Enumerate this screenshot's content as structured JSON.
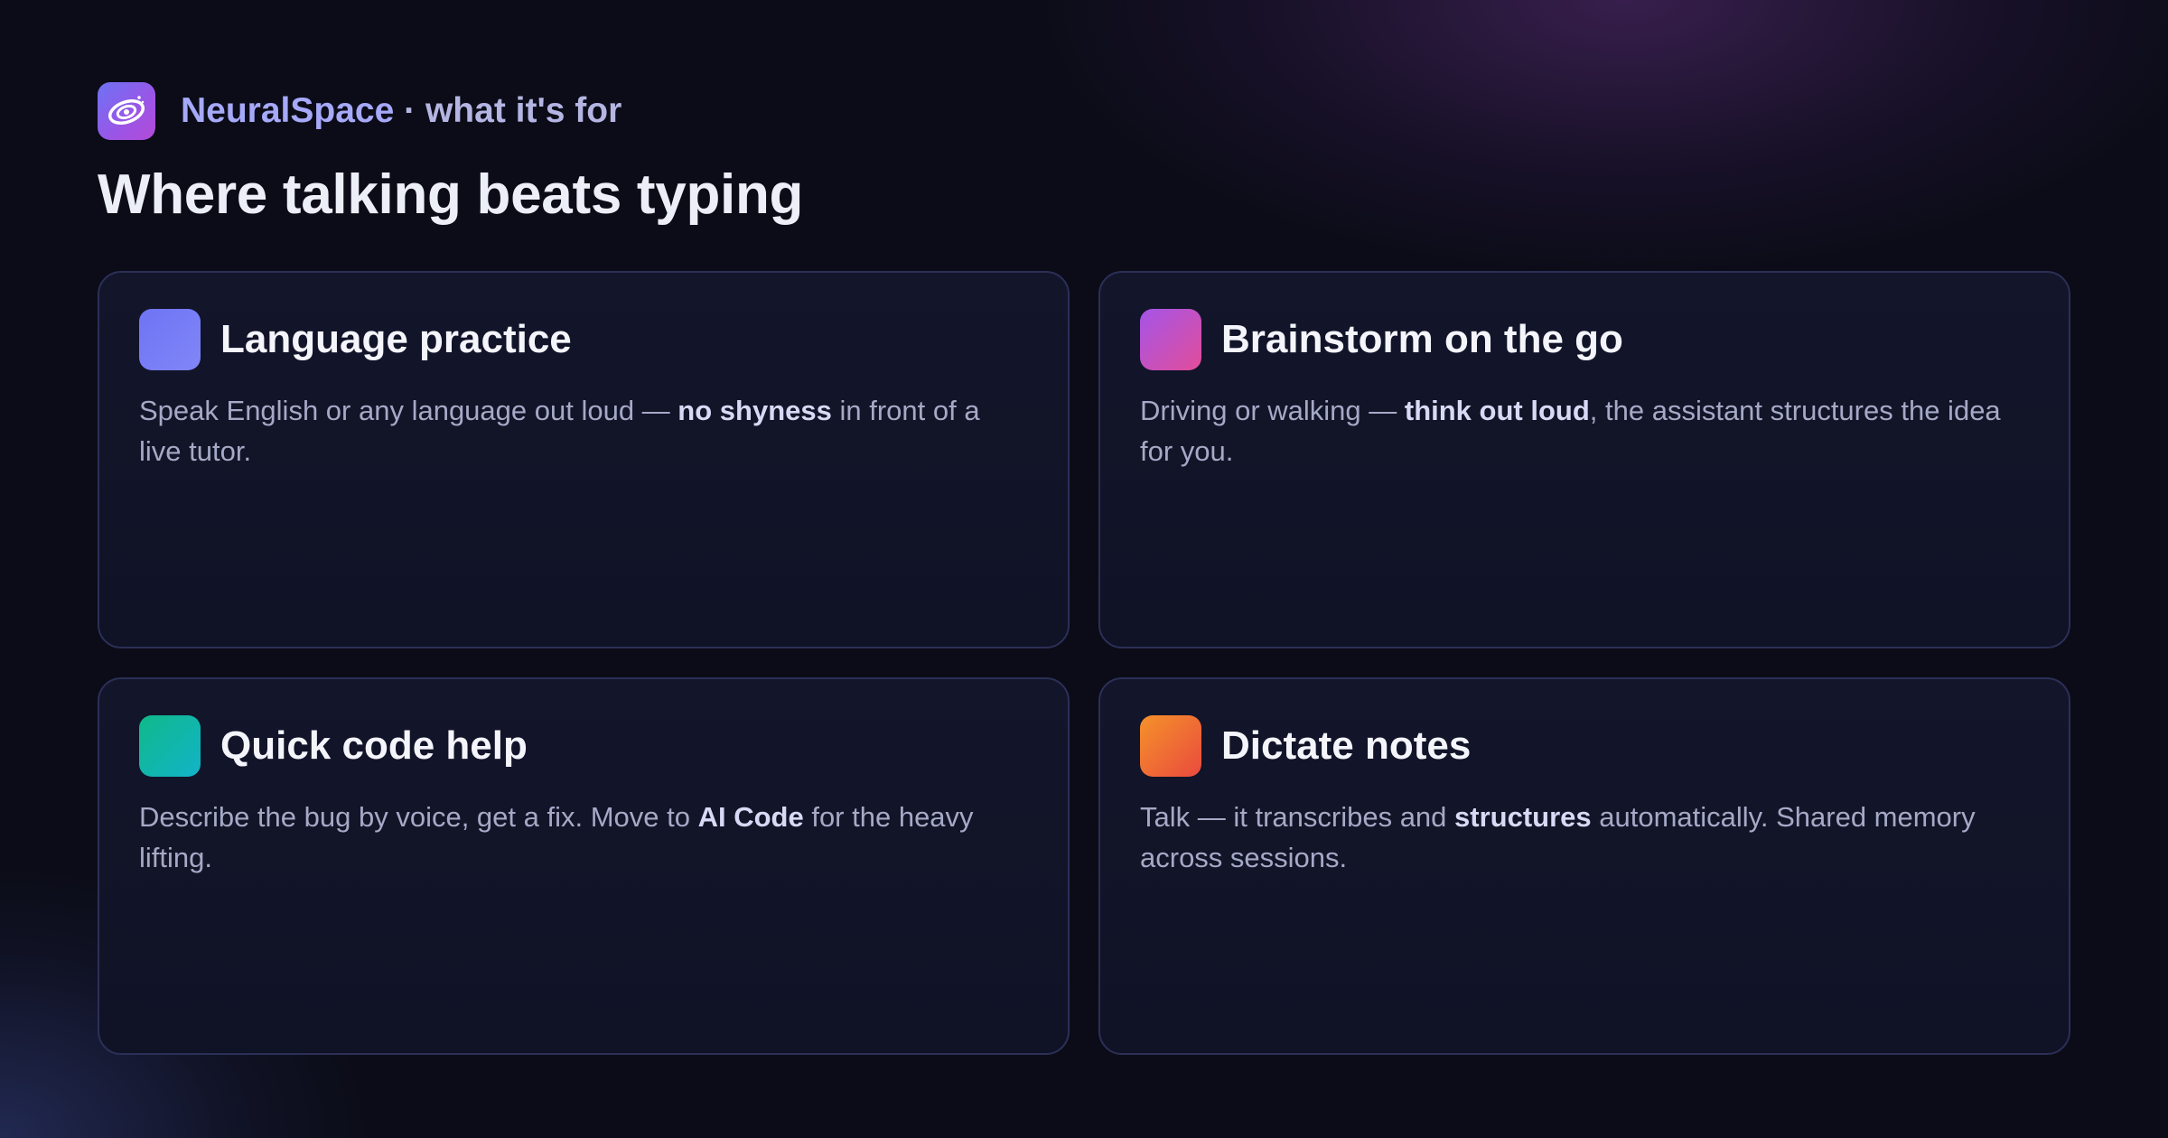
{
  "brand": {
    "name": "NeuralSpace",
    "separator": " · ",
    "tagline": "what it's for",
    "logo_icon": "spiral-galaxy-icon"
  },
  "headline": "Where talking beats typing",
  "cards": [
    {
      "title": "Language practice",
      "icon": "indigo-square-icon",
      "icon_colors": [
        "#6e74f4",
        "#8186f7"
      ],
      "desc_pre": "Speak English or any language out loud — ",
      "desc_bold": "no shyness",
      "desc_post": " in front of a live tutor."
    },
    {
      "title": "Brainstorm on the go",
      "icon": "purple-pink-square-icon",
      "icon_colors": [
        "#a455e8",
        "#e24d9a"
      ],
      "desc_pre": "Driving or walking — ",
      "desc_bold": "think out loud",
      "desc_post": ", the assistant structures the idea for you."
    },
    {
      "title": "Quick code help",
      "icon": "teal-square-icon",
      "icon_colors": [
        "#10b98a",
        "#12b3c8"
      ],
      "desc_pre": "Describe the bug by voice, get a fix. Move to ",
      "desc_bold": "AI Code",
      "desc_post": " for the heavy lifting."
    },
    {
      "title": "Dictate notes",
      "icon": "orange-red-square-icon",
      "icon_colors": [
        "#f5922a",
        "#ea4a3e"
      ],
      "desc_pre": "Talk — it transcribes and ",
      "desc_bold": "structures",
      "desc_post": " automatically. Shared memory across sessions."
    }
  ]
}
